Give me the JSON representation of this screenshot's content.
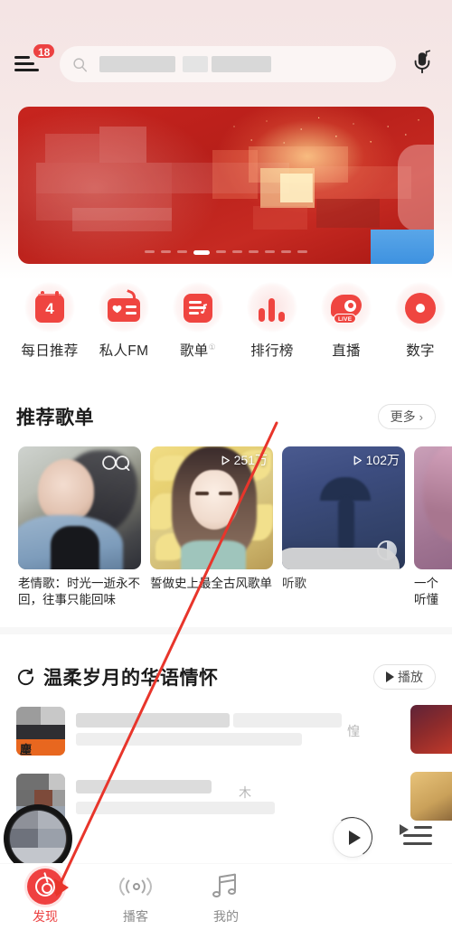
{
  "app": {
    "name": "NetEase Cloud Music",
    "theme_color": "#ec4141",
    "background": "#ffffff"
  },
  "header": {
    "menu_icon": "hamburger-icon",
    "menu_badge": "18",
    "search": {
      "icon": "search-icon",
      "placeholder": "",
      "value": "",
      "redacted": true
    },
    "mic_icon": "microphone-icon"
  },
  "banner": {
    "name": "promo-banner",
    "redacted": true,
    "dots_total": 10,
    "active_dot": 4
  },
  "categories": [
    {
      "id": "daily-recommend",
      "label": "每日推荐",
      "icon": "calendar-icon",
      "day": "4"
    },
    {
      "id": "private-fm",
      "label": "私人FM",
      "icon": "radio-icon"
    },
    {
      "id": "playlist",
      "label": "歌单",
      "icon": "songlist-icon",
      "sup": "①"
    },
    {
      "id": "ranking",
      "label": "排行榜",
      "icon": "bar-chart-icon"
    },
    {
      "id": "live",
      "label": "直播",
      "icon": "live-icon",
      "tag": "LIVE"
    },
    {
      "id": "digital-album",
      "label": "数字",
      "icon": "digital-album-icon"
    }
  ],
  "recommended": {
    "title": "推荐歌单",
    "more_label": "更多",
    "more_chevron": "›",
    "cards": [
      {
        "title": "老情歌：时光一逝永不回，往事只能回味",
        "badge": "",
        "badge_icon": "infinity-icon",
        "art": "woman-photo"
      },
      {
        "title": "誓做史上最全古风歌单",
        "badge": "251万",
        "badge_icon": "play-count-icon",
        "art": "anime-girl"
      },
      {
        "title": "听歌",
        "badge": "102万",
        "badge_icon": "play-count-icon",
        "art": "umbrella-silhouette",
        "redacted": true
      },
      {
        "title": "一个",
        "subtitle": "听懂",
        "badge": "",
        "badge_icon": "",
        "art": "pink-portrait",
        "redacted": true
      }
    ]
  },
  "feed": {
    "refresh_icon": "refresh-icon",
    "title": "温柔岁月的华语情怀",
    "play_label": "播放",
    "play_icon": "play-icon",
    "rows": [
      {
        "title": "",
        "subtitle": "",
        "visible_char": "惶",
        "redacted": true,
        "play_icon": "play-circle-icon"
      },
      {
        "title": "",
        "subtitle": "",
        "visible_char": "木",
        "redacted": true,
        "play_icon": "play-circle-icon"
      }
    ]
  },
  "mini_player": {
    "disc": "album-disc",
    "play_icon": "play-icon",
    "queue_icon": "playlist-queue-icon"
  },
  "tabbar": {
    "items": [
      {
        "id": "discover",
        "label": "发现",
        "icon": "netease-logo-icon",
        "active": true
      },
      {
        "id": "podcast",
        "label": "播客",
        "icon": "podcast-icon",
        "active": false
      },
      {
        "id": "mine",
        "label": "我的",
        "icon": "music-note-icon",
        "active": false
      }
    ]
  },
  "annotation": {
    "type": "arrow",
    "color": "#e8352b",
    "points": "from (305,470) to (60,995)",
    "target": "discover-tab"
  }
}
